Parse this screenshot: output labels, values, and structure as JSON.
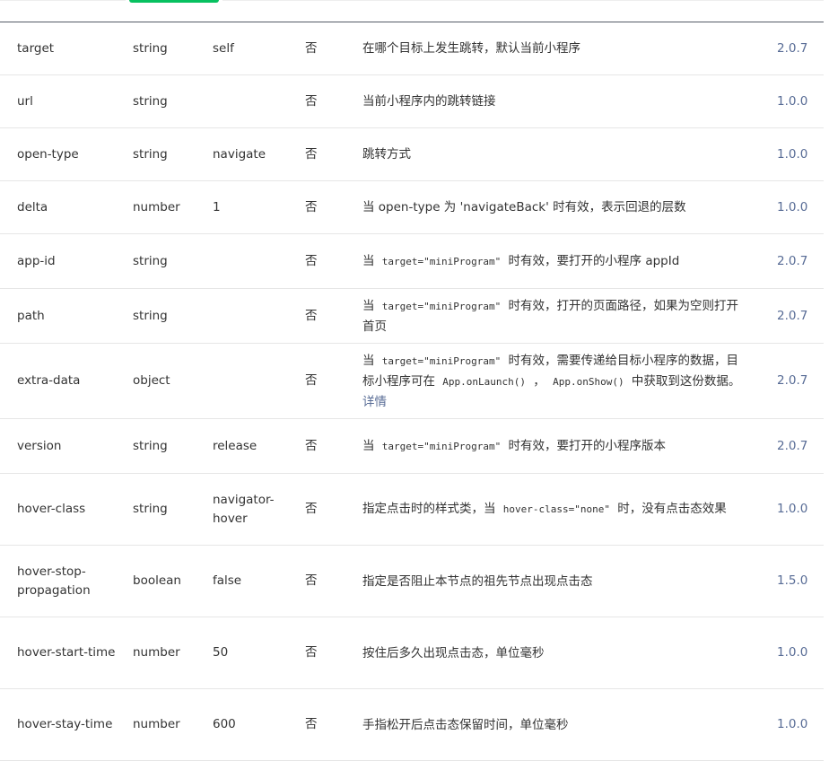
{
  "rows": [
    {
      "name": "target",
      "type": "string",
      "default": "self",
      "required": "否",
      "desc": [
        {
          "t": "在哪个目标上发生跳转，默认当前小程序"
        }
      ],
      "version": "2.0.7"
    },
    {
      "name": "url",
      "type": "string",
      "default": "",
      "required": "否",
      "desc": [
        {
          "t": "当前小程序内的跳转链接"
        }
      ],
      "version": "1.0.0"
    },
    {
      "name": "open-type",
      "type": "string",
      "default": "navigate",
      "required": "否",
      "desc": [
        {
          "t": "跳转方式"
        }
      ],
      "version": "1.0.0"
    },
    {
      "name": "delta",
      "type": "number",
      "default": "1",
      "required": "否",
      "desc": [
        {
          "t": "当 open-type 为 'navigateBack' 时有效，表示回退的层数"
        }
      ],
      "version": "1.0.0"
    },
    {
      "name": "app-id",
      "type": "string",
      "default": "",
      "required": "否",
      "desc": [
        {
          "t": "当 "
        },
        {
          "t": "target=\"miniProgram\"",
          "code": true
        },
        {
          "t": " 时有效，要打开的小程序 appId"
        }
      ],
      "version": "2.0.7"
    },
    {
      "name": "path",
      "type": "string",
      "default": "",
      "required": "否",
      "desc": [
        {
          "t": "当 "
        },
        {
          "t": "target=\"miniProgram\"",
          "code": true
        },
        {
          "t": " 时有效，打开的页面路径，如果为空则打开首页"
        }
      ],
      "version": "2.0.7"
    },
    {
      "name": "extra-data",
      "type": "object",
      "default": "",
      "required": "否",
      "desc": [
        {
          "t": "当 "
        },
        {
          "t": "target=\"miniProgram\"",
          "code": true
        },
        {
          "t": " 时有效，需要传递给目标小程序的数据，目标小程序可在 "
        },
        {
          "t": "App.onLaunch()",
          "code": true
        },
        {
          "t": " ， "
        },
        {
          "t": "App.onShow()",
          "code": true
        },
        {
          "t": " 中获取到这份数据。"
        },
        {
          "t": "详情",
          "link": true
        }
      ],
      "version": "2.0.7"
    },
    {
      "name": "version",
      "type": "string",
      "default": "release",
      "required": "否",
      "desc": [
        {
          "t": "当 "
        },
        {
          "t": "target=\"miniProgram\"",
          "code": true
        },
        {
          "t": " 时有效，要打开的小程序版本"
        }
      ],
      "version": "2.0.7"
    },
    {
      "name": "hover-class",
      "type": "string",
      "default": "navigator-hover",
      "required": "否",
      "desc": [
        {
          "t": "指定点击时的样式类，当 "
        },
        {
          "t": "hover-class=\"none\"",
          "code": true
        },
        {
          "t": " 时，没有点击态效果"
        }
      ],
      "version": "1.0.0"
    },
    {
      "name": "hover-stop-propagation",
      "type": "boolean",
      "default": "false",
      "required": "否",
      "desc": [
        {
          "t": "指定是否阻止本节点的祖先节点出现点击态"
        }
      ],
      "version": "1.5.0"
    },
    {
      "name": "hover-start-time",
      "type": "number",
      "default": "50",
      "required": "否",
      "desc": [
        {
          "t": "按住后多久出现点击态，单位毫秒"
        }
      ],
      "version": "1.0.0"
    },
    {
      "name": "hover-stay-time",
      "type": "number",
      "default": "600",
      "required": "否",
      "desc": [
        {
          "t": "手指松开后点击态保留时间，单位毫秒"
        }
      ],
      "version": "1.0.0"
    }
  ]
}
